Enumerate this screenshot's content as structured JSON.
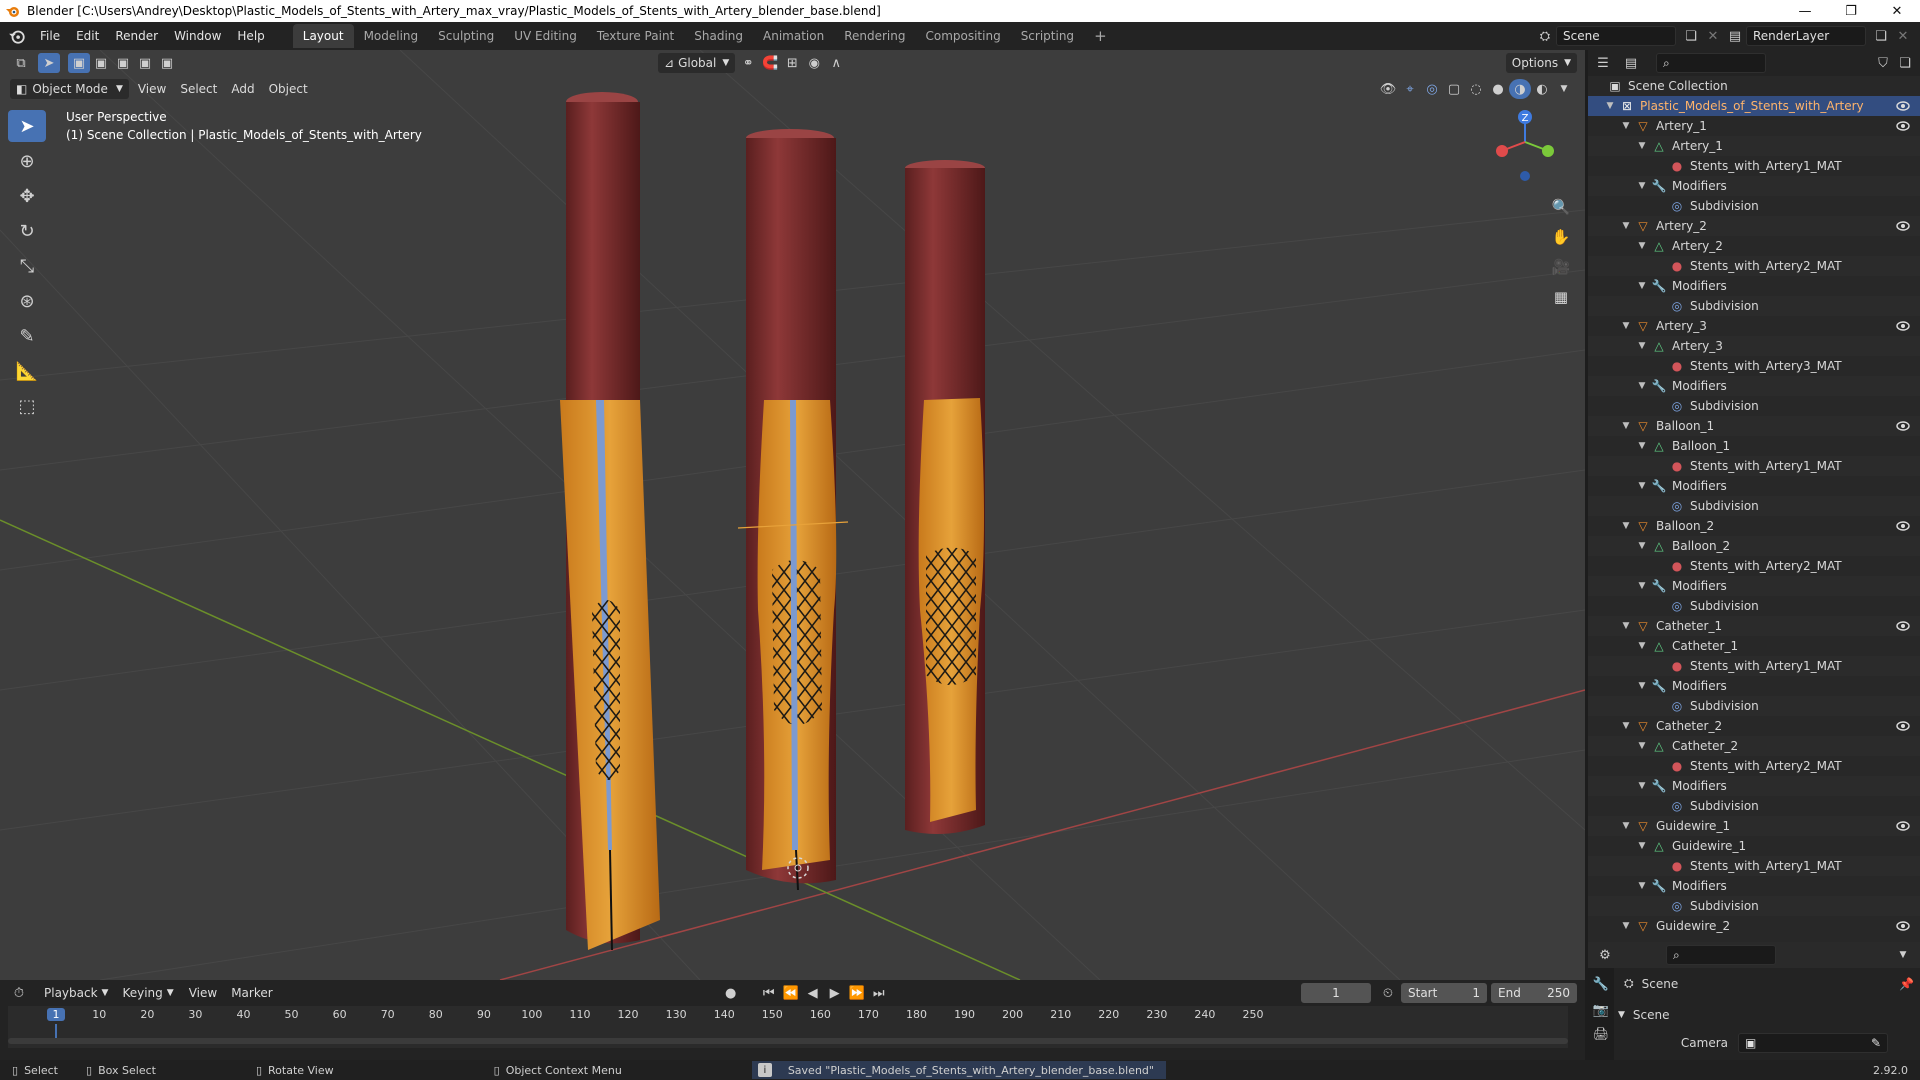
{
  "window": {
    "title": "Blender [C:\\Users\\Andrey\\Desktop\\Plastic_Models_of_Stents_with_Artery_max_vray/Plastic_Models_of_Stents_with_Artery_blender_base.blend]",
    "minimize": "—",
    "restore": "❐",
    "close": "✕"
  },
  "menu": [
    "File",
    "Edit",
    "Render",
    "Window",
    "Help"
  ],
  "workspaces": [
    "Layout",
    "Modeling",
    "Sculpting",
    "UV Editing",
    "Texture Paint",
    "Shading",
    "Animation",
    "Rendering",
    "Compositing",
    "Scripting"
  ],
  "active_workspace": "Layout",
  "add_workspace": "+",
  "scene_name": "Scene",
  "view_layer": "RenderLayer",
  "viewport": {
    "mode": "Object Mode",
    "menus": [
      "View",
      "Select",
      "Add",
      "Object"
    ],
    "transform_orientation": "Global",
    "options_label": "Options",
    "perspective_label": "User Perspective",
    "collection_label": "(1) Scene Collection | Plastic_Models_of_Stents_with_Artery",
    "gizmo_z": "Z"
  },
  "outliner": {
    "root": "Scene Collection",
    "collection": "Plastic_Models_of_Stents_with_Artery",
    "objects": [
      {
        "name": "Artery_1",
        "mesh": "Artery_1",
        "material": "Stents_with_Artery1_MAT"
      },
      {
        "name": "Artery_2",
        "mesh": "Artery_2",
        "material": "Stents_with_Artery2_MAT"
      },
      {
        "name": "Artery_3",
        "mesh": "Artery_3",
        "material": "Stents_with_Artery3_MAT"
      },
      {
        "name": "Balloon_1",
        "mesh": "Balloon_1",
        "material": "Stents_with_Artery1_MAT"
      },
      {
        "name": "Balloon_2",
        "mesh": "Balloon_2",
        "material": "Stents_with_Artery2_MAT"
      },
      {
        "name": "Catheter_1",
        "mesh": "Catheter_1",
        "material": "Stents_with_Artery1_MAT"
      },
      {
        "name": "Catheter_2",
        "mesh": "Catheter_2",
        "material": "Stents_with_Artery2_MAT"
      },
      {
        "name": "Guidewire_1",
        "mesh": "Guidewire_1",
        "material": "Stents_with_Artery1_MAT"
      }
    ],
    "last_object": "Guidewire_2",
    "modifiers_label": "Modifiers",
    "modifier_name": "Subdivision"
  },
  "properties": {
    "context": "Scene",
    "panel": "Scene",
    "camera_label": "Camera"
  },
  "timeline": {
    "menus": [
      "Playback",
      "Keying",
      "View",
      "Marker"
    ],
    "current_frame": "1",
    "start_label": "Start",
    "start": "1",
    "end_label": "End",
    "end": "250",
    "ticks": [
      "1",
      "10",
      "20",
      "30",
      "40",
      "50",
      "60",
      "70",
      "80",
      "90",
      "100",
      "110",
      "120",
      "130",
      "140",
      "150",
      "160",
      "170",
      "180",
      "190",
      "200",
      "210",
      "220",
      "230",
      "240",
      "250"
    ]
  },
  "status": {
    "select": "Select",
    "box_select": "Box Select",
    "rotate_view": "Rotate View",
    "context_menu": "Object Context Menu",
    "message": "Saved \"Plastic_Models_of_Stents_with_Artery_blender_base.blend\"",
    "version": "2.92.0"
  }
}
